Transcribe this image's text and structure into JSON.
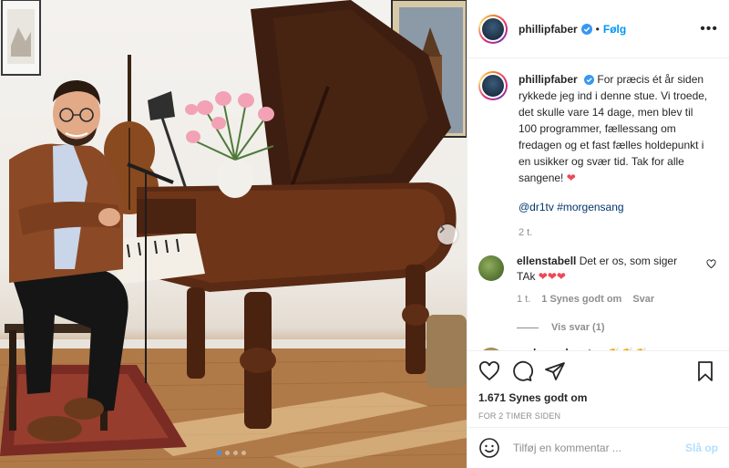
{
  "post": {
    "username": "phillipfaber",
    "follow_label": "Følg",
    "separator": "•",
    "more_icon": "more-horizontal-icon",
    "caption_username": "phillipfaber",
    "caption_text": "For præcis ét år siden rykkede jeg ind i denne stue. Vi troede, det skulle vare 14 dage, men blev til 100 programmer, fællessang om fredagen og et fast fælles holdepunkt i en usikker og svær tid. Tak for alle sangene!",
    "caption_emoji": "❤",
    "caption_tags": "@dr1tv #morgensang",
    "caption_age": "2 t.",
    "likes": "1.671 Synes godt om",
    "timestamp": "FOR 2 TIMER SIDEN",
    "comment_placeholder": "Tilføj en kommentar ...",
    "post_label": "Slå op",
    "carousel": {
      "total": 4,
      "active": 1
    }
  },
  "comments": [
    {
      "username": "ellenstabell",
      "text": "Det er os, som siger TAk",
      "emoji": "❤❤❤",
      "age": "1 t.",
      "likes": "1 Synes godt om",
      "reply": "Svar",
      "view_replies": "Vis svar (1)"
    },
    {
      "username": "andersenkarsten",
      "emoji": "👏👏👏"
    }
  ],
  "colors": {
    "accent": "#0095f6",
    "verified": "#3897f0",
    "heart": "#ed4956",
    "muted": "#8e8e8e",
    "text": "#262626"
  }
}
